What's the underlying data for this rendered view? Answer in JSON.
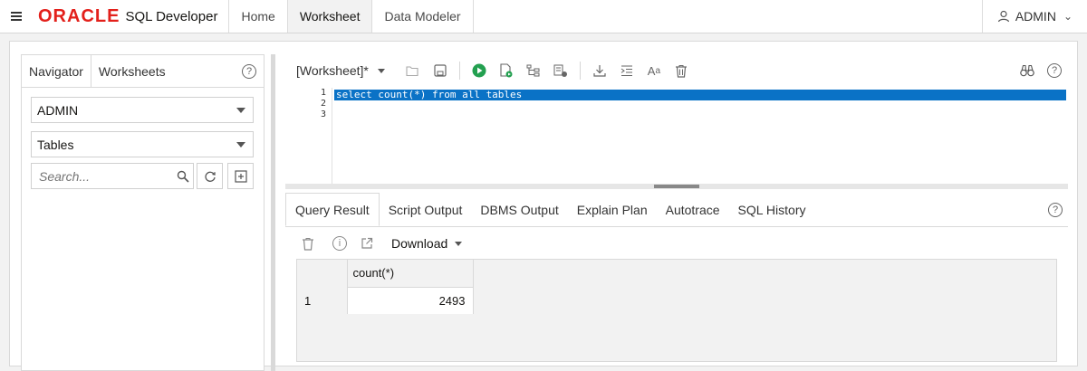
{
  "topbar": {
    "brand": "ORACLE",
    "product": "SQL Developer",
    "tabs": [
      {
        "label": "Home"
      },
      {
        "label": "Worksheet"
      },
      {
        "label": "Data Modeler"
      }
    ],
    "user": "ADMIN"
  },
  "left": {
    "tabs": [
      {
        "label": "Navigator"
      },
      {
        "label": "Worksheets"
      }
    ],
    "schema": "ADMIN",
    "object_type": "Tables",
    "search_placeholder": "Search..."
  },
  "worksheet": {
    "name": "[Worksheet]*",
    "lines": [
      "select count(*) from all tables",
      "",
      ""
    ],
    "line_numbers": [
      "1",
      "2",
      "3"
    ]
  },
  "results": {
    "tabs": [
      {
        "label": "Query Result"
      },
      {
        "label": "Script Output"
      },
      {
        "label": "DBMS Output"
      },
      {
        "label": "Explain Plan"
      },
      {
        "label": "Autotrace"
      },
      {
        "label": "SQL History"
      }
    ],
    "download_label": "Download",
    "columns": [
      "count(*)"
    ],
    "rows": [
      {
        "num": "1",
        "value": "2493"
      }
    ]
  }
}
